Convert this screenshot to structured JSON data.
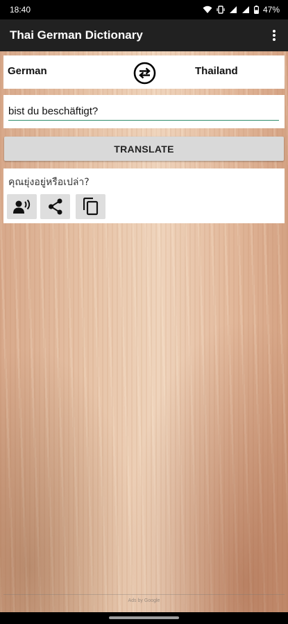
{
  "status_bar": {
    "time": "18:40",
    "battery": "47%"
  },
  "app_bar": {
    "title": "Thai German Dictionary"
  },
  "languages": {
    "source": "German",
    "target": "Thailand"
  },
  "input": {
    "value": "bist du beschäftigt?"
  },
  "translate_button": {
    "label": "TRANSLATE"
  },
  "result": {
    "text": "คุณยุ่งอยู่หรือเปล่า?"
  },
  "footer": {
    "text": "Ads by Google"
  },
  "colors": {
    "app_bar": "#212121",
    "underline": "#2e8b6a",
    "button": "#d9d9d9"
  }
}
